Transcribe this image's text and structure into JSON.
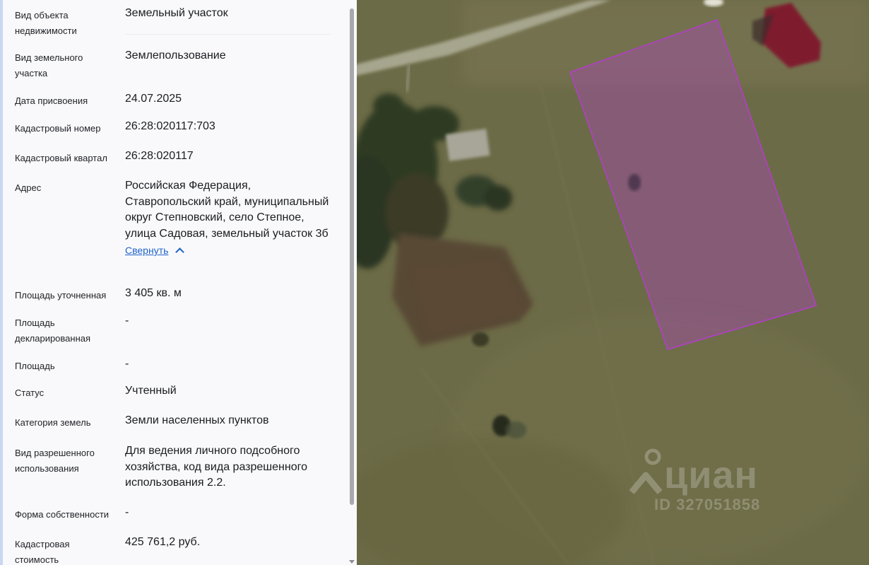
{
  "property": {
    "rows": [
      {
        "label": "Вид объекта недвижимости",
        "value": "Земельный участок"
      },
      {
        "label": "Вид земельного участка",
        "value": "Землепользование"
      },
      {
        "label": "Дата присвоения",
        "value": "24.07.2025"
      },
      {
        "label": "Кадастровый номер",
        "value": "26:28:020117:703"
      },
      {
        "label": "Кадастровый квартал",
        "value": "26:28:020117"
      },
      {
        "label": "Адрес",
        "value": "Российская Федерация, Ставропольский край, муниципальный округ Степновский, село Степное, улица Садовая, земельный участок 3б"
      },
      {
        "label": "Площадь уточненная",
        "value": "3 405 кв. м"
      },
      {
        "label": "Площадь декларированная",
        "value": "-"
      },
      {
        "label": "Площадь",
        "value": "-"
      },
      {
        "label": "Статус",
        "value": "Учтенный"
      },
      {
        "label": "Категория земель",
        "value": "Земли населенных пунктов"
      },
      {
        "label": "Вид разрешенного использования",
        "value": "Для ведения личного подсобного хозяйства, код вида разрешенного использования 2.2."
      },
      {
        "label": "Форма собственности",
        "value": "-"
      },
      {
        "label": "Кадастровая стоимость",
        "value": "425 761,2 руб."
      }
    ],
    "collapse_link": "Свернуть"
  },
  "map": {
    "watermark_brand": "циан",
    "watermark_id": "ID 327051858",
    "parcel_color": "#b23fc8",
    "icons": [
      "cian-logo-icon",
      "chevron-up-icon"
    ]
  }
}
